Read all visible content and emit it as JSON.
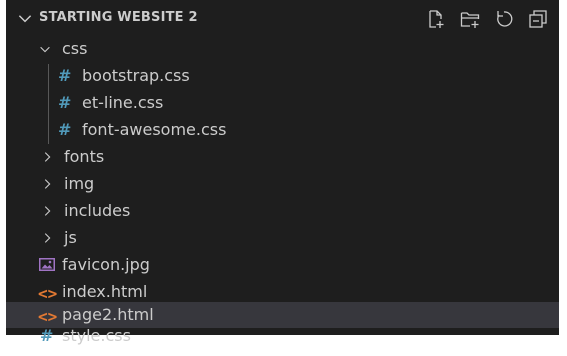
{
  "explorer": {
    "section_title": "STARTING WEBSITE 2",
    "actions": [
      {
        "name": "new-file",
        "icon": "new-file-icon"
      },
      {
        "name": "new-folder",
        "icon": "new-folder-icon"
      },
      {
        "name": "refresh",
        "icon": "refresh-icon"
      },
      {
        "name": "collapse-all",
        "icon": "collapse-all-icon"
      }
    ],
    "tree": [
      {
        "label": "css",
        "type": "folder",
        "expanded": true
      },
      {
        "label": "bootstrap.css",
        "type": "file",
        "icon": "#"
      },
      {
        "label": "et-line.css",
        "type": "file",
        "icon": "#"
      },
      {
        "label": "font-awesome.css",
        "type": "file",
        "icon": "#"
      },
      {
        "label": "fonts",
        "type": "folder",
        "expanded": false
      },
      {
        "label": "img",
        "type": "folder",
        "expanded": false
      },
      {
        "label": "includes",
        "type": "folder",
        "expanded": false
      },
      {
        "label": "js",
        "type": "folder",
        "expanded": false
      },
      {
        "label": "favicon.jpg",
        "type": "file",
        "icon": "image-icon"
      },
      {
        "label": "index.html",
        "type": "file",
        "icon": "<>"
      },
      {
        "label": "page2.html",
        "type": "file",
        "icon": "<>",
        "selected": true
      },
      {
        "label": "style.css",
        "type": "file",
        "icon": "#"
      }
    ]
  },
  "colors": {
    "background": "#1e1e1e",
    "text": "#cccccc",
    "selected_row": "#37373d",
    "css_icon": "#519aba",
    "html_icon": "#e37933",
    "image_icon": "#a074c4"
  }
}
